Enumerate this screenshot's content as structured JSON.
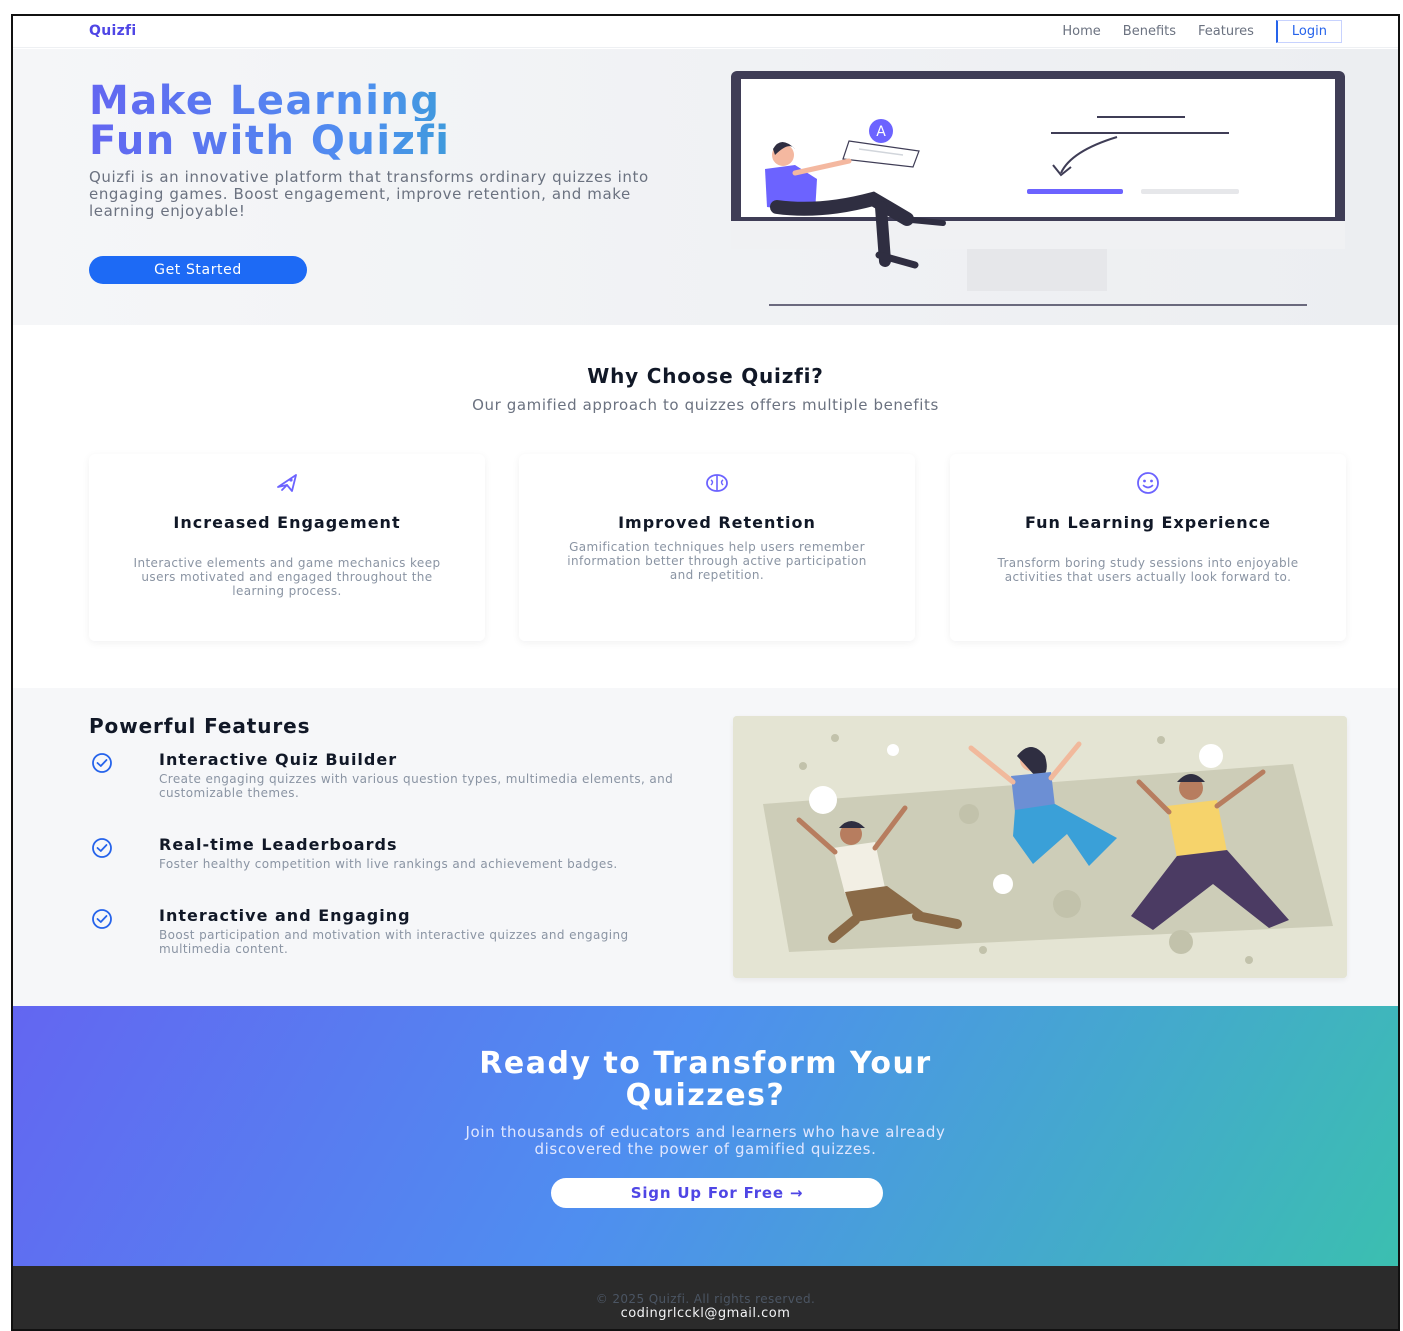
{
  "nav": {
    "brand": "Quizfi",
    "links": [
      "Home",
      "Benefits",
      "Features"
    ],
    "login": "Login"
  },
  "hero": {
    "title_line1": "Make Learning",
    "title_line2": "Fun with Quizfi",
    "description": "Quizfi is an innovative platform that transforms ordinary quizzes into engaging games. Boost engagement, improve retention, and make learning enjoyable!",
    "cta": "Get Started",
    "art_badge": "A"
  },
  "why": {
    "title": "Why Choose Quizfi?",
    "subtitle": "Our gamified approach to quizzes offers multiple benefits",
    "cards": [
      {
        "icon": "rocket-icon",
        "title": "Increased Engagement",
        "description": "Interactive elements and game mechanics keep users motivated and engaged throughout the learning process."
      },
      {
        "icon": "brain-icon",
        "title": "Improved Retention",
        "description": "Gamification techniques help users remember information better through active participation and repetition."
      },
      {
        "icon": "smile-icon",
        "title": "Fun Learning Experience",
        "description": "Transform boring study sessions into enjoyable activities that users actually look forward to."
      }
    ]
  },
  "features": {
    "title": "Powerful Features",
    "items": [
      {
        "title": "Interactive Quiz Builder",
        "description": "Create engaging quizzes with various question types, multimedia elements, and customizable themes."
      },
      {
        "title": "Real-time Leaderboards",
        "description": "Foster healthy competition with live rankings and achievement badges."
      },
      {
        "title": "Interactive and Engaging",
        "description": "Boost participation and motivation with interactive quizzes and engaging multimedia content."
      }
    ]
  },
  "cta_band": {
    "title_line1": "Ready to Transform Your",
    "title_line2": "Quizzes?",
    "desc_line1": "Join thousands of educators and learners who have already",
    "desc_line2": "discovered the power of gamified quizzes.",
    "button": "Sign Up For Free →"
  },
  "footer": {
    "copyright": "© 2025 Quizfi. All rights reserved.",
    "email": "codingrlcckl@gmail.com"
  },
  "colors": {
    "primary": "#4f46e5",
    "accent": "#14b8a6",
    "button": "#1d6af5",
    "footer": "#2b2b2b"
  }
}
